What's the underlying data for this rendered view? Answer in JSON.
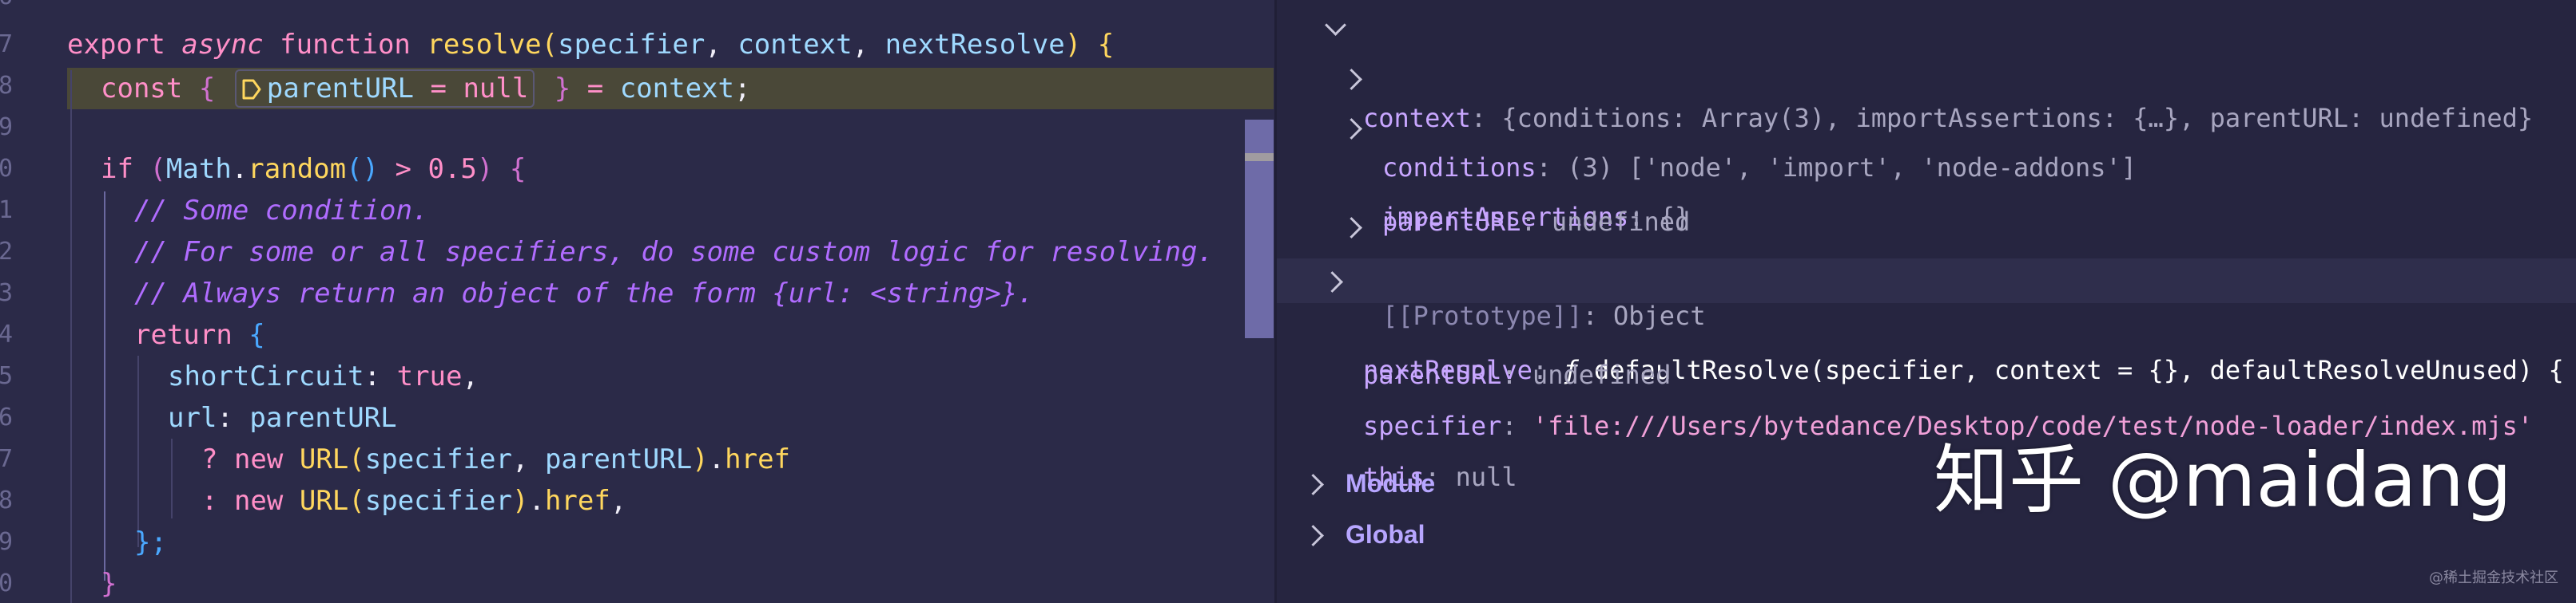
{
  "editor": {
    "line_numbers": [
      "6",
      "7",
      "8",
      "9",
      "0",
      "1",
      "2",
      "3",
      "4",
      "5",
      "6",
      "7",
      "8",
      "9",
      "0"
    ],
    "lines": {
      "l1": {
        "export": "export ",
        "async": "async ",
        "function": "function ",
        "name": "resolve",
        "open": "(",
        "p1": "specifier",
        "c1": ", ",
        "p2": "context",
        "c2": ", ",
        "p3": "nextResolve",
        "close": ")",
        "brace": " {"
      },
      "l2": {
        "const": "const ",
        "ob": "{ ",
        "hint_name": "parentURL",
        "hint_eq": " = ",
        "hint_val": "null",
        "cb": " }",
        "eq": " = ",
        "ctx": "context",
        "semi": ";"
      },
      "l4": {
        "if": "if ",
        "open": "(",
        "math": "Math",
        "dot": ".",
        "random": "random",
        "call": "()",
        "gt": " > ",
        "num": "0.5",
        "close": ")",
        "brace": " {"
      },
      "c1": "// Some condition.",
      "c2": "// For some or all specifiers, do some custom logic for resolving.",
      "c3": "// Always return an object of the form {url: <string>}.",
      "ret": {
        "return": "return ",
        "brace": "{"
      },
      "sc": {
        "key": "shortCircuit",
        "colon": ": ",
        "val": "true",
        "comma": ","
      },
      "url": {
        "key": "url",
        "colon": ": ",
        "val": "parentURL"
      },
      "t1": {
        "q": "? ",
        "new": "new ",
        "cls": "URL",
        "open": "(",
        "a1": "specifier",
        "c": ", ",
        "a2": "parentURL",
        "close": ")",
        "dot": ".",
        "prop": "href"
      },
      "t2": {
        "q": ": ",
        "new": "new ",
        "cls": "URL",
        "open": "(",
        "a1": "specifier",
        "close": ")",
        "dot": ".",
        "prop": "href",
        "comma": ","
      },
      "endret": "};",
      "endif": "}"
    }
  },
  "variables": {
    "context": {
      "key": "context",
      "sep": ": ",
      "value": "{conditions: Array(3), importAssertions: {…}, parentURL: undefined}"
    },
    "conditions": {
      "key": "conditions",
      "sep": ": ",
      "value": "(3) ['node', 'import', 'node-addons']"
    },
    "importAssertions": {
      "key": "importAssertions",
      "sep": ": ",
      "value": "{}"
    },
    "parentURL_inner": {
      "key": "parentURL",
      "sep": ": ",
      "value": "undefined"
    },
    "prototype": {
      "key": "[[Prototype]]",
      "sep": ": ",
      "value": "Object"
    },
    "nextResolve": {
      "key": "nextResolve",
      "sep": ": ",
      "f": "ƒ ",
      "value": "defaultResolve(specifier, context = {}, defaultResolveUnused) {"
    },
    "parentURL": {
      "key": "parentURL",
      "sep": ": ",
      "value": "undefined"
    },
    "specifier": {
      "key": "specifier",
      "sep": ": ",
      "value": "'file:///Users/bytedance/Desktop/code/test/node-loader/index.mjs'"
    },
    "this": {
      "key": "this",
      "sep": ": ",
      "value": "null"
    }
  },
  "scopes": {
    "module": "Module",
    "global": "Global"
  },
  "watermark": "知乎 @maidang",
  "small_watermark": "@稀土掘金技术社区"
}
